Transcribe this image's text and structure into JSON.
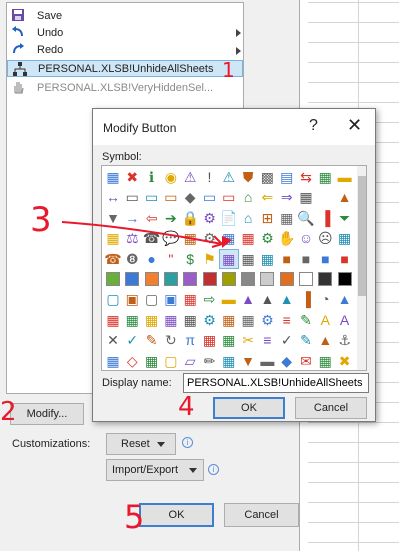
{
  "command_list": [
    {
      "label": "Save",
      "icon": "save-icon"
    },
    {
      "label": "Undo",
      "icon": "undo-icon",
      "has_submenu": true
    },
    {
      "label": "Redo",
      "icon": "redo-icon",
      "has_submenu": true
    },
    {
      "label": "PERSONAL.XLSB!UnhideAllSheets",
      "icon": "macro-flow-icon",
      "selected": true
    },
    {
      "label": "PERSONAL.XLSB!VeryHiddenSel...",
      "icon": "hand-icon"
    }
  ],
  "left_buttons": {
    "modify": "Modify...",
    "customizations_label": "Customizations:",
    "reset": "Reset",
    "import_export": "Import/Export",
    "ok": "OK",
    "cancel": "Cancel"
  },
  "dialog": {
    "title": "Modify Button",
    "help": "?",
    "close": "✕",
    "symbol_label": "Symbol:",
    "display_name_label": "Display name:",
    "display_name_value": "PERSONAL.XLSB!UnhideAllSheets",
    "ok": "OK",
    "cancel": "Cancel"
  },
  "annotations": [
    "1",
    "2",
    "3",
    "4",
    "5"
  ],
  "colors": {
    "selection": "#cfe6f7",
    "primary_border": "#3c7fd1",
    "annotation_red": "#e8192c"
  }
}
